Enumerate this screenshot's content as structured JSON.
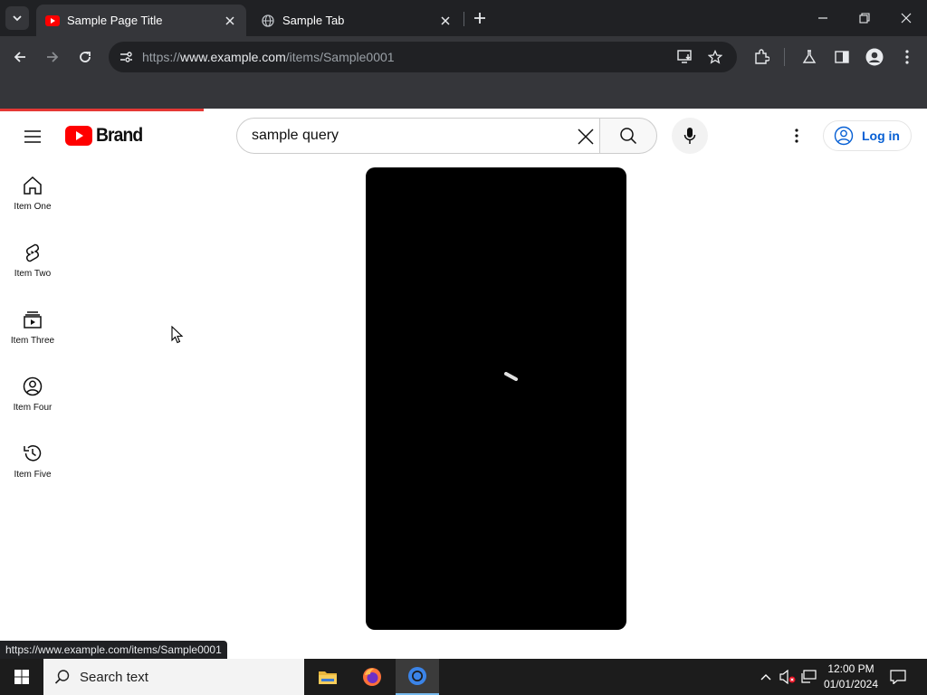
{
  "browser": {
    "tabs": [
      {
        "title": "Sample Page Title",
        "active": true
      },
      {
        "title": "Sample Tab",
        "active": false
      }
    ],
    "url": {
      "scheme": "https://",
      "host": "www.example.com",
      "path": "/items/Sample0001"
    }
  },
  "youtube": {
    "logo_text": "Brand",
    "search_query": "sample query",
    "sign_in_label": "Log in",
    "guide": [
      {
        "label": "Item One",
        "icon": "home-icon"
      },
      {
        "label": "Item Two",
        "icon": "shorts-icon"
      },
      {
        "label": "Item Three",
        "icon": "subscriptions-icon"
      },
      {
        "label": "Item Four",
        "icon": "you-icon"
      },
      {
        "label": "Item Five",
        "icon": "history-icon"
      }
    ],
    "load_progress": 0.22,
    "status_link": "https://www.example.com/items/Sample0001"
  },
  "taskbar": {
    "search_placeholder": "Search text",
    "time": "12:00 PM",
    "date": "01/01/2024"
  },
  "colors": {
    "accent_red": "#ff0000",
    "link_blue": "#065fd4",
    "progress_red": "#e53935"
  }
}
